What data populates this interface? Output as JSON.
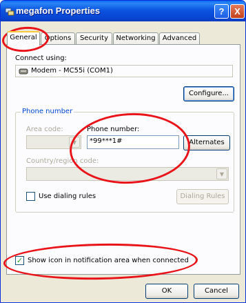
{
  "window": {
    "title": "megafon Properties",
    "help_glyph": "?",
    "close_glyph": "X"
  },
  "tabs": [
    {
      "label": "General",
      "active": true
    },
    {
      "label": "Options"
    },
    {
      "label": "Security"
    },
    {
      "label": "Networking"
    },
    {
      "label": "Advanced"
    }
  ],
  "general": {
    "connect_using_label": "Connect using:",
    "modem_name": "Modem - MC55i (COM1)",
    "configure_label": "Configure...",
    "phone_group_title": "Phone number",
    "area_code_label": "Area code:",
    "area_code_value": "",
    "phone_number_label": "Phone number:",
    "phone_number_value": "*99***1#",
    "alternates_label": "Alternates",
    "country_label": "Country/region code:",
    "country_value": "",
    "use_dialing_rules_label": "Use dialing rules",
    "use_dialing_rules_checked": false,
    "dialing_rules_label": "Dialing Rules",
    "show_icon_label": "Show icon in notification area when connected",
    "show_icon_checked": true
  },
  "footer": {
    "ok_label": "OK",
    "cancel_label": "Cancel"
  },
  "colors": {
    "titlebar": "#0A54E0",
    "annotation": "#E8141A",
    "group_title": "#0046D5"
  }
}
